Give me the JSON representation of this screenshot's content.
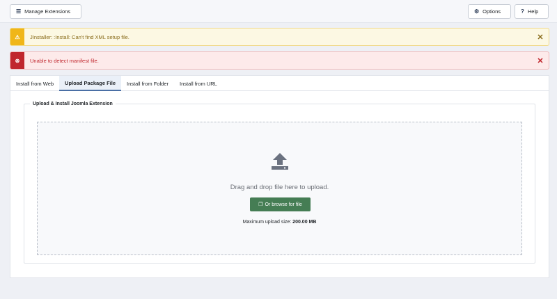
{
  "toolbar": {
    "manage_label": "Manage Extensions",
    "manage_icon": "list-icon",
    "options_label": "Options",
    "options_icon": "gear-icon",
    "help_label": "Help",
    "help_icon": "question-icon"
  },
  "alerts": [
    {
      "type": "warning",
      "icon": "warning-icon",
      "message": "JInstaller: :Install: Can't find XML setup file.",
      "close": "✕"
    },
    {
      "type": "error",
      "icon": "error-icon",
      "message": "Unable to detect manifest file.",
      "close": "✕"
    }
  ],
  "tabs": [
    {
      "label": "Install from Web",
      "active": false
    },
    {
      "label": "Upload Package File",
      "active": true
    },
    {
      "label": "Install from Folder",
      "active": false
    },
    {
      "label": "Install from URL",
      "active": false
    }
  ],
  "upload": {
    "legend": "Upload & Install Joomla Extension",
    "drag_text": "Drag and drop file here to upload.",
    "browse_label": "Or browse for file",
    "browse_icon": "file-copy-icon",
    "max_size_label": "Maximum upload size:",
    "max_size_value": "200.00 MB"
  },
  "colors": {
    "warning": "#f0b619",
    "error": "#c0262d",
    "browse_button": "#457d54",
    "active_tab": "#4a6fa5"
  }
}
